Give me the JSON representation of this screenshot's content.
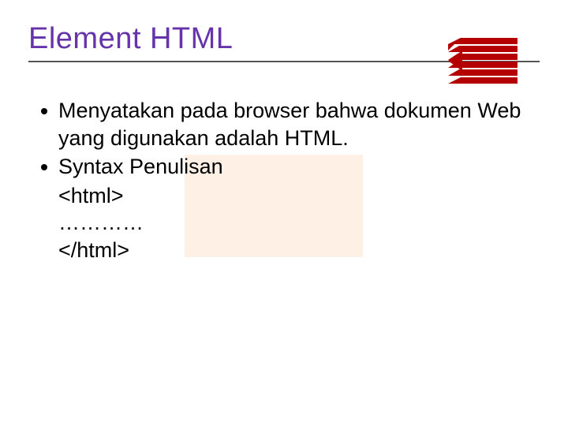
{
  "title": "Element HTML",
  "bullets": [
    "Menyatakan pada browser bahwa dokumen Web yang digunakan adalah HTML.",
    "Syntax Penulisan"
  ],
  "code_lines": [
    "<html>",
    "…………",
    "</html>"
  ],
  "logo_name": "stacked-arrow-logo"
}
